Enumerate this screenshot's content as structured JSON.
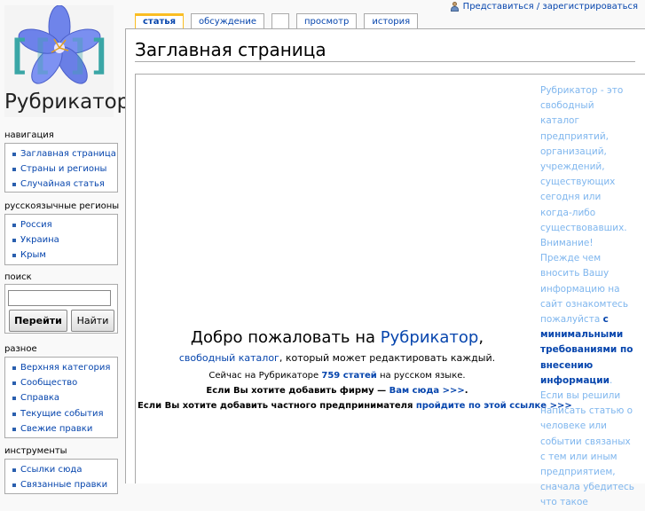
{
  "personal_tools": {
    "login_label": "Представиться / зарегистрироваться"
  },
  "logo": {
    "text": "Рубрикатор"
  },
  "tabs": [
    {
      "label": "статья"
    },
    {
      "label": "обсуждение"
    },
    {
      "label": ""
    },
    {
      "label": "просмотр"
    },
    {
      "label": "история"
    }
  ],
  "page_title": "Заглавная страница",
  "welcome": {
    "line1_prefix": "Добро пожаловать на ",
    "line1_link": "Рубрикатор",
    "line1_suffix": ",",
    "line2_link": "свободный каталог",
    "line2_rest": ", который может редактировать каждый.",
    "line3_prefix": "Сейчас на Рубрикаторе ",
    "line3_link": "759 статей",
    "line3_suffix": " на русском языке.",
    "line4_prefix": "Если Вы хотите добавить фирму — ",
    "line4_link": "Вам сюда >>>",
    "line4_suffix": ".",
    "line5_prefix": "Если Вы хотите добавить частного предпринимателя ",
    "line5_link": "пройдите по этой ссылке >>>"
  },
  "sidenote": {
    "part1": "Рубрикатор - это свободный каталог предприятий, организаций, учреждений, существующих сегодня или когда-либо существовавших. Внимание! Прежде чем вносить Вашу информацию на сайт ознакомтесь пожалуйста ",
    "link": "с минимальными требованиями по внесению информации",
    "part2": ". Если вы решили написать статью о человеке или событии связаных с тем или иным предприятием, сначала убедитесь что такое"
  },
  "navigation": {
    "title": "навигация",
    "items": [
      "Заглавная страница",
      "Страны и регионы",
      "Случайная статья"
    ]
  },
  "regions": {
    "title": "русскоязычные регионы",
    "items": [
      "Россия",
      "Украина",
      "Крым"
    ]
  },
  "search": {
    "title": "поиск",
    "input_value": "",
    "go_label": "Перейти",
    "find_label": "Найти"
  },
  "misc": {
    "title": "разное",
    "items": [
      "Верхняя категория",
      "Сообщество",
      "Справка",
      "Текущие события",
      "Свежие правки"
    ]
  },
  "tools": {
    "title": "инструменты",
    "items": [
      "Ссылки сюда",
      "Связанные правки"
    ]
  }
}
